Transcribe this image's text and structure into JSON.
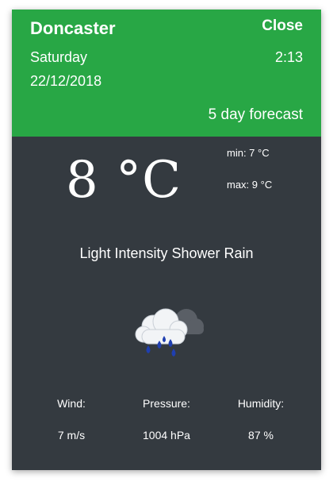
{
  "header": {
    "city": "Doncaster",
    "close_label": "Close",
    "day": "Saturday",
    "time": "2:13",
    "date": "22/12/2018",
    "forecast_link": "5 day forecast"
  },
  "current": {
    "temperature": "8 °C",
    "min": "min: 7 °C",
    "max": "max: 9 °C",
    "condition": "Light Intensity Shower Rain",
    "icon": "cloud-rain-icon"
  },
  "stats": {
    "wind_label": "Wind:",
    "wind_value": "7 m/s",
    "pressure_label": "Pressure:",
    "pressure_value": "1004 hPa",
    "humidity_label": "Humidity:",
    "humidity_value": "87 %"
  },
  "colors": {
    "header": "#28a745",
    "body": "#343a40",
    "text": "#ffffff"
  }
}
